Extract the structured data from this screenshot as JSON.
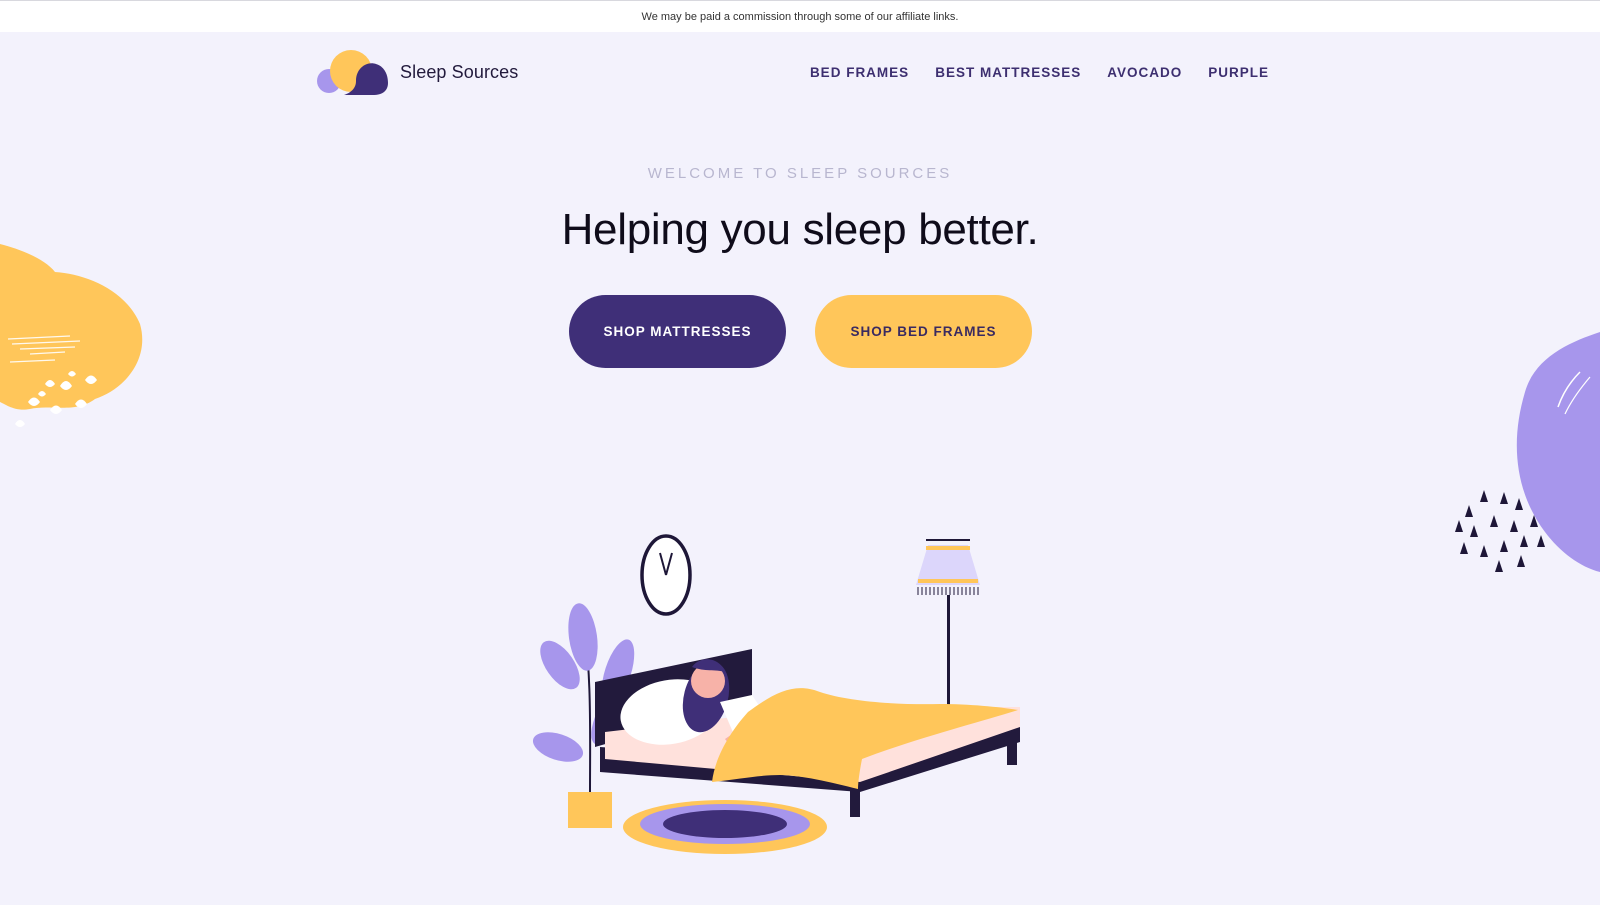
{
  "affiliate_notice": "We may be paid a commission through some of our affiliate links.",
  "brand": {
    "name": "Sleep Sources",
    "colors": {
      "purple_dark": "#3f2f78",
      "purple_light": "#a796ec",
      "yellow": "#ffc65a",
      "background": "#f3f2fc"
    }
  },
  "nav": {
    "items": [
      {
        "label": "BED FRAMES"
      },
      {
        "label": "BEST MATTRESSES"
      },
      {
        "label": "AVOCADO"
      },
      {
        "label": "PURPLE"
      }
    ]
  },
  "hero": {
    "eyebrow": "WELCOME TO SLEEP SOURCES",
    "headline": "Helping you sleep better.",
    "cta_primary": "SHOP MATTRESSES",
    "cta_secondary": "SHOP BED FRAMES"
  },
  "icons": {
    "logo": "cloud-sun-logo-icon",
    "illustration": "woman-sleeping-illustration"
  }
}
